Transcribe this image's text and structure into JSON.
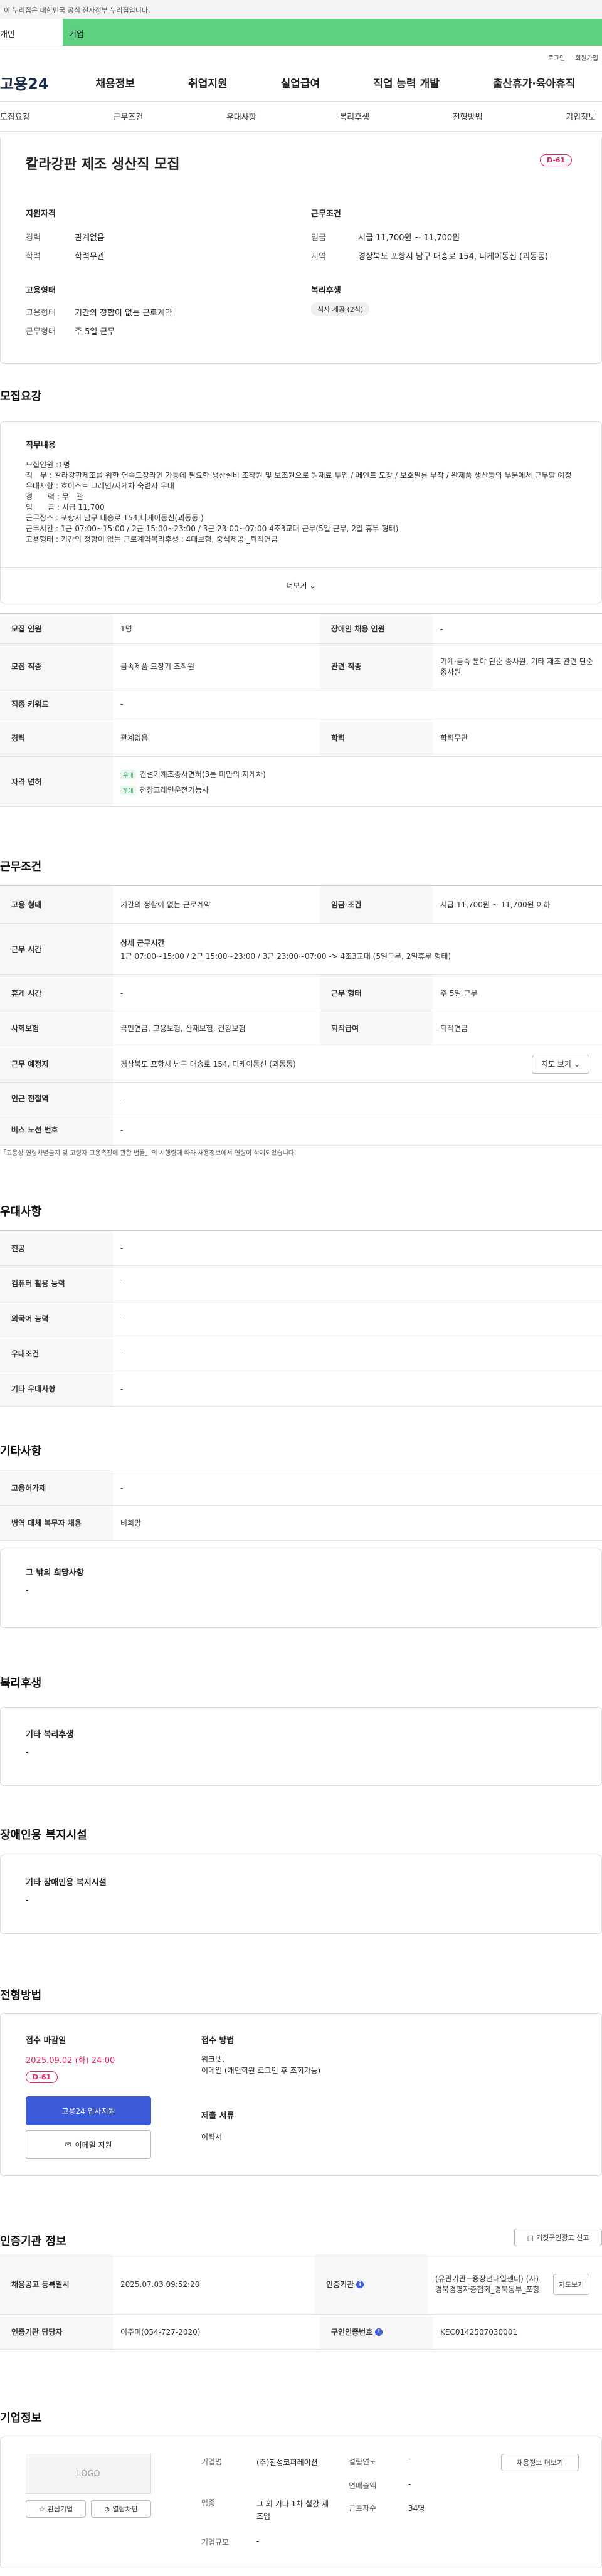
{
  "header": {
    "gov_notice": "이 누리집은 대한민국 공식 전자정부 누리집입니다.",
    "tab_personal": "개인",
    "tab_company": "기업",
    "login": "로그인",
    "join": "회원가입",
    "logo": "고용24",
    "menu": [
      "채용정보",
      "취업지원",
      "실업급여",
      "직업 능력 개발",
      "출산휴가·육아휴직"
    ]
  },
  "subnav": [
    "모집요강",
    "근무조건",
    "우대사항",
    "복리후생",
    "전형방법",
    "기업정보"
  ],
  "summary": {
    "title": "칼라강판 제조 생산직 모집",
    "dday": "D-61",
    "qual_title": "지원자격",
    "career_lbl": "경력",
    "career": "관계없음",
    "edu_lbl": "학력",
    "edu": "학력무관",
    "cond_title": "근무조건",
    "wage_lbl": "임금",
    "wage": "시급 11,700원 ~ 11,700원",
    "loc_lbl": "지역",
    "loc": "경상북도 포항시 남구 대송로 154, 디케이동신 (괴동동)",
    "emp_title": "고용형태",
    "emptype_lbl": "고용형태",
    "emptype": "기간의 정함이 없는 근로계약",
    "worktype_lbl": "근무형태",
    "worktype": "주 5일 근무",
    "welfare_title": "복리후생",
    "welfare_tag": "식사 제공 (2식)"
  },
  "recruit": {
    "section": "모집요강",
    "job_title": "직무내용",
    "lines": [
      "모집인원 :1명",
      "직　무 : 칼라강판제조를 위한 연속도장라인 가동에 필요한 생산설비 조작원 및 보조원으로  원재료 투입 / 페인트 도장 / 보호필름 부착 / 완제품 생산등의 부분에서 근무할 예정",
      "우대사항 : 호이스트 크레인/지게차 숙련자 우대",
      "경　　력 : 무　관",
      "임　　금 : 시급 11,700",
      "근무장소 : 포항시 남구 대송로 154,디케이동신(괴동동 )",
      "근무시간 : 1근 07:00~15:00 / 2근 15:00~23:00 / 3근 23:00~07:00  4조3교대 근무(5일 근무, 2일 휴무 형태)",
      "고용형태 : 기간의 정함이 없는 근로계약복리후생 : 4대보험, 중식제공 _퇴직연금"
    ],
    "more": "더보기",
    "rows": [
      {
        "th": "모집 인원",
        "td": "1명",
        "th2": "장애인 채용 인원",
        "td2": "-"
      },
      {
        "th": "모집 직종",
        "td": "금속제품 도장기 조작원",
        "th2": "관련 직종",
        "td2": "기계·금속 분야 단순 종사원, 기타 제조 관련 단순 종사원"
      },
      {
        "th": "직종 키워드",
        "td": "-"
      },
      {
        "th": "경력",
        "td": "관계없음",
        "th2": "학력",
        "td2": "학력무관"
      }
    ],
    "license_th": "자격 면허",
    "license_tag": "우대",
    "licenses": [
      "건설기계조종사면허(3톤 미만의 지게차)",
      "천장크레인운전기능사"
    ]
  },
  "work": {
    "section": "근무조건",
    "emp_th": "고용 형태",
    "emp_td": "기간의 정함이 없는 근로계약",
    "wage_th": "임금 조건",
    "wage_td": "시급 11,700원 ~ 11,700원 이하",
    "time_th": "근무 시간",
    "time_sub": "상세 근무시간",
    "time_td": "1근 07:00~15:00 / 2근 15:00~23:00 / 3근 23:00~07:00  -> 4조3교대 (5일근무, 2일휴무 형태)",
    "rest_th": "휴게 시간",
    "rest_td": "-",
    "form_th": "근무 형태",
    "form_td": "주 5일 근무",
    "ins_th": "사회보험",
    "ins_td": "국민연금, 고용보험, 산재보험, 건강보험",
    "ret_th": "퇴직급여",
    "ret_td": "퇴직연금",
    "place_th": "근무 예정지",
    "place_td": "경상북도 포항시 남구 대송로 154, 디케이동신 (괴동동)",
    "map_btn": "지도 보기",
    "sub_th": "인근 전철역",
    "sub_td": "-",
    "bus_th": "버스 노선 번호",
    "bus_td": "-",
    "note": "「고용상 연령차별금지 및 고령자 고용촉진에 관한 법률」의 시행령에 따라 채용정보에서 연령이 삭제되었습니다."
  },
  "pref": {
    "section": "우대사항",
    "rows": [
      {
        "th": "전공",
        "td": "-"
      },
      {
        "th": "컴퓨터 활용 능력",
        "td": "-"
      },
      {
        "th": "외국어 능력",
        "td": "-"
      },
      {
        "th": "우대조건",
        "td": "-"
      },
      {
        "th": "기타 우대사항",
        "td": "-"
      }
    ]
  },
  "etc": {
    "section": "기타사항",
    "rows": [
      {
        "th": "고용허가제",
        "td": "-"
      },
      {
        "th": "병역 대체 복무자 채용",
        "td": "비희망"
      }
    ],
    "box_title": "그 밖의 희망사항",
    "box_val": "-"
  },
  "benefit": {
    "section": "복리후생",
    "box_title": "기타 복리후생",
    "box_val": "-"
  },
  "facility": {
    "section": "장애인용 복지시설",
    "box_title": "기타 장애인용 복지시설",
    "box_val": "-"
  },
  "select": {
    "section": "전형방법",
    "deadline_lbl": "접수 마감일",
    "deadline": "2025.09.02 (화) 24:00",
    "dday": "D-61",
    "apply_btn": "고용24 입사지원",
    "email_btn": "이메일 지원",
    "method_lbl": "접수 방법",
    "method": "워크넷,\n이메일 (개인회원 로그인 후 조회가능)",
    "docs_lbl": "제출 서류",
    "docs": "이력서"
  },
  "cert": {
    "section": "인증기관 정보",
    "report_btn": "거짓구인광고 신고",
    "date_th": "채용공고 등록일시",
    "date_td": "2025.07.03 09:52:20",
    "org_th": "인증기관",
    "org_td": "(유관기관−중장년대일센터) (사)경북경영자총협회_경북동부_포항",
    "map_btn": "지도보기",
    "mgr_th": "인증기관 담당자",
    "mgr_td": "이주미(054-727-2020)",
    "no_th": "구인인증번호",
    "no_td": "KEC0142507030001"
  },
  "company": {
    "section": "기업정보",
    "logo": "LOGO",
    "fav_btn": "관심기업",
    "block_btn": "열람차단",
    "name_lbl": "기업명",
    "name": "(주)진성코퍼레이션",
    "year_lbl": "설립연도",
    "year": "-",
    "info_btn": "채용정보 더보기",
    "sales_lbl": "연매출액",
    "sales": "-",
    "biz_lbl": "업종",
    "biz": "그 외 기타 1차 철강 제조업",
    "emp_lbl": "근로자수",
    "emp": "34명",
    "size_lbl": "기업규모",
    "size": "-"
  }
}
